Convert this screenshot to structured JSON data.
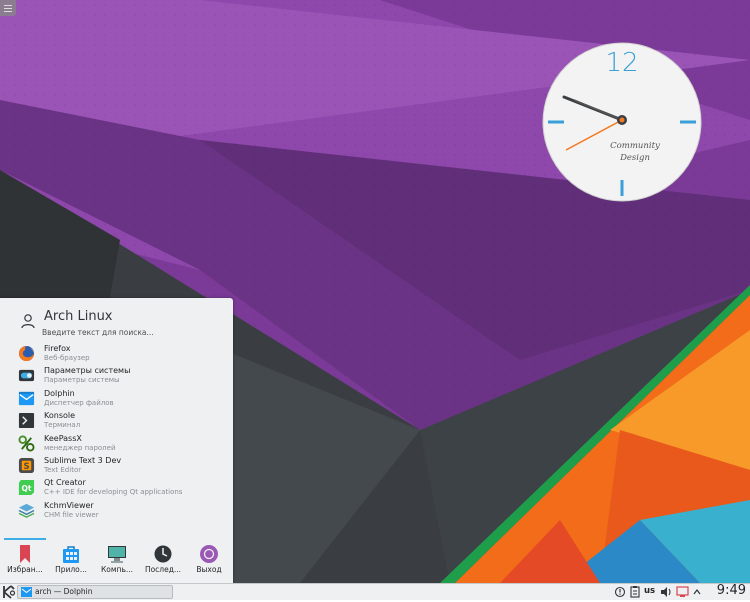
{
  "desktop": {
    "clock_widget": {
      "numeral": "12",
      "brand_lines": [
        "Community",
        "Design"
      ],
      "time_shown": "9:49"
    }
  },
  "launcher": {
    "user_name": "Arch Linux",
    "search_placeholder": "Введите текст для поиска...",
    "favorites": [
      {
        "name": "Firefox",
        "description": "Веб-браузер",
        "icon": "firefox-icon"
      },
      {
        "name": "Параметры системы",
        "description": "Параметры системы",
        "icon": "system-settings-icon"
      },
      {
        "name": "Dolphin",
        "description": "Диспетчер файлов",
        "icon": "dolphin-icon"
      },
      {
        "name": "Konsole",
        "description": "Терминал",
        "icon": "konsole-icon"
      },
      {
        "name": "KeePassX",
        "description": "менеджер паролей",
        "icon": "keepassx-icon"
      },
      {
        "name": "Sublime Text 3 Dev",
        "description": "Text Editor",
        "icon": "sublime-text-icon"
      },
      {
        "name": "Qt Creator",
        "description": "C++ IDE for developing Qt applications",
        "icon": "qt-creator-icon"
      },
      {
        "name": "KchmViewer",
        "description": "CHM file viewer",
        "icon": "kchmviewer-icon"
      }
    ],
    "tabs": [
      {
        "label": "Избран...",
        "icon": "bookmark-icon",
        "active": true
      },
      {
        "label": "Прило...",
        "icon": "applications-icon",
        "active": false
      },
      {
        "label": "Компь...",
        "icon": "computer-icon",
        "active": false
      },
      {
        "label": "Послед...",
        "icon": "recent-clock-icon",
        "active": false
      },
      {
        "label": "Выход",
        "icon": "power-icon",
        "active": false
      }
    ]
  },
  "panel": {
    "task_label": "arch — Dolphin",
    "keyboard_layout": "us",
    "time": "9:49"
  },
  "colors": {
    "accent": "#3daee9",
    "panel_bg": "#eff0f1",
    "clock_accent": "#3a9fd8",
    "second_hand": "#f47920"
  }
}
